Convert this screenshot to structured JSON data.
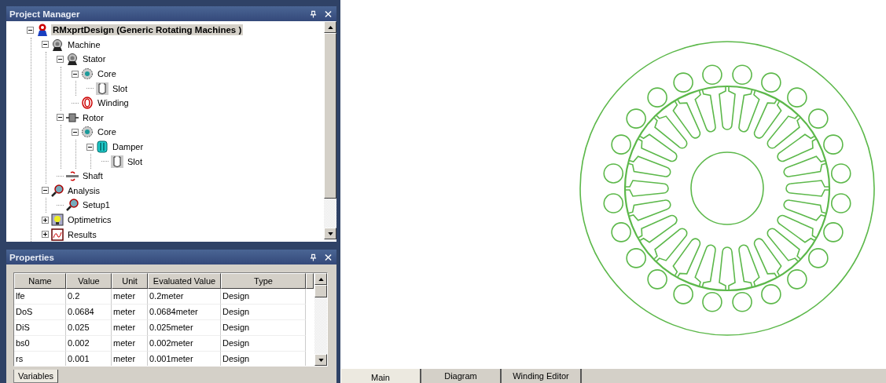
{
  "project_manager": {
    "title": "Project Manager",
    "tree": [
      {
        "label": "RMxprtDesign (Generic Rotating Machines )",
        "kind": "design",
        "selected": true,
        "expanded": true,
        "children": [
          {
            "label": "Machine",
            "kind": "machine",
            "selected": false,
            "expanded": true,
            "children": [
              {
                "label": "Stator",
                "kind": "stator",
                "selected": false,
                "expanded": true,
                "children": [
                  {
                    "label": "Core",
                    "kind": "core",
                    "selected": false,
                    "expanded": true,
                    "children": [
                      {
                        "label": "Slot",
                        "kind": "slot",
                        "selected": false
                      }
                    ]
                  },
                  {
                    "label": "Winding",
                    "kind": "winding",
                    "selected": false
                  }
                ]
              },
              {
                "label": "Rotor",
                "kind": "rotor",
                "selected": false,
                "expanded": true,
                "children": [
                  {
                    "label": "Core",
                    "kind": "core",
                    "selected": false,
                    "expanded": true,
                    "children": [
                      {
                        "label": "Damper",
                        "kind": "damper",
                        "selected": false,
                        "expanded": true,
                        "children": [
                          {
                            "label": "Slot",
                            "kind": "slot",
                            "selected": false
                          }
                        ]
                      }
                    ]
                  }
                ]
              },
              {
                "label": "Shaft",
                "kind": "shaft",
                "selected": false
              }
            ]
          },
          {
            "label": "Analysis",
            "kind": "analysis",
            "selected": false,
            "expanded": true,
            "children": [
              {
                "label": "Setup1",
                "kind": "setup",
                "selected": false
              }
            ]
          },
          {
            "label": "Optimetrics",
            "kind": "optimetrics",
            "selected": false,
            "expanded": false
          },
          {
            "label": "Results",
            "kind": "results",
            "selected": false,
            "expanded": false
          }
        ]
      }
    ]
  },
  "properties": {
    "title": "Properties",
    "table": {
      "columns": [
        "Name",
        "Value",
        "Unit",
        "Evaluated Value",
        "Type"
      ],
      "rows": [
        [
          "lfe",
          "0.2",
          "meter",
          "0.2meter",
          "Design"
        ],
        [
          "DoS",
          "0.0684",
          "meter",
          "0.0684meter",
          "Design"
        ],
        [
          "DiS",
          "0.025",
          "meter",
          "0.025meter",
          "Design"
        ],
        [
          "bs0",
          "0.002",
          "meter",
          "0.002meter",
          "Design"
        ],
        [
          "rs",
          "0.001",
          "meter",
          "0.001meter",
          "Design"
        ]
      ]
    },
    "tabs": [
      {
        "label": "Variables",
        "selected": true
      }
    ]
  },
  "view_tabs": [
    {
      "label": "Main",
      "selected": true
    },
    {
      "label": "Diagram",
      "selected": false
    },
    {
      "label": "Winding Editor",
      "selected": false
    }
  ]
}
